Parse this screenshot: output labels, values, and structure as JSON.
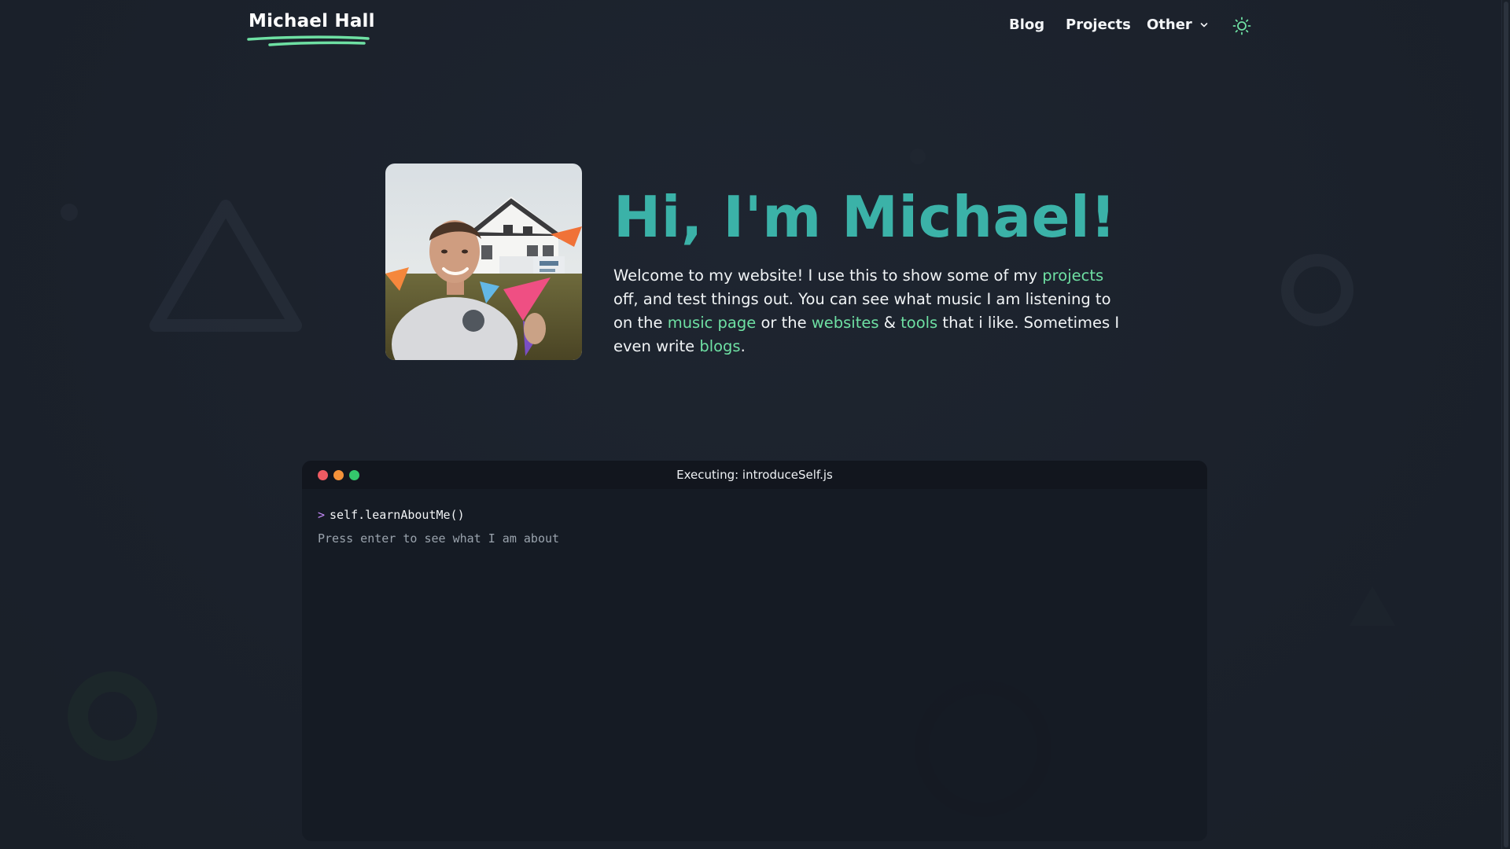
{
  "site": {
    "name": "Michael Hall",
    "accent_color": "#3bb2a8",
    "link_color": "#6ee0a3"
  },
  "nav": {
    "items": [
      {
        "label": "Blog"
      },
      {
        "label": "Projects"
      },
      {
        "label": "Other"
      }
    ],
    "theme_toggle_icon": "sun-icon"
  },
  "hero": {
    "title": "Hi, I'm Michael!",
    "avatar_icon": "profile-photo",
    "text": {
      "part1": "Welcome to my website! I use this to show some of my ",
      "link_projects": "projects",
      "part2": " off, and test things out. You can see what music I am listening to on the ",
      "link_music": "music page",
      "part3": " or the ",
      "link_websites": "websites",
      "part4": " & ",
      "link_tools": "tools",
      "part5": " that i like. Sometimes I even write ",
      "link_blogs": "blogs",
      "part6": "."
    }
  },
  "terminal": {
    "title": "Executing: introduceSelf.js",
    "prompt_symbol": ">",
    "command": "self.learnAboutMe()",
    "hint": "Press enter to see what I am about"
  }
}
